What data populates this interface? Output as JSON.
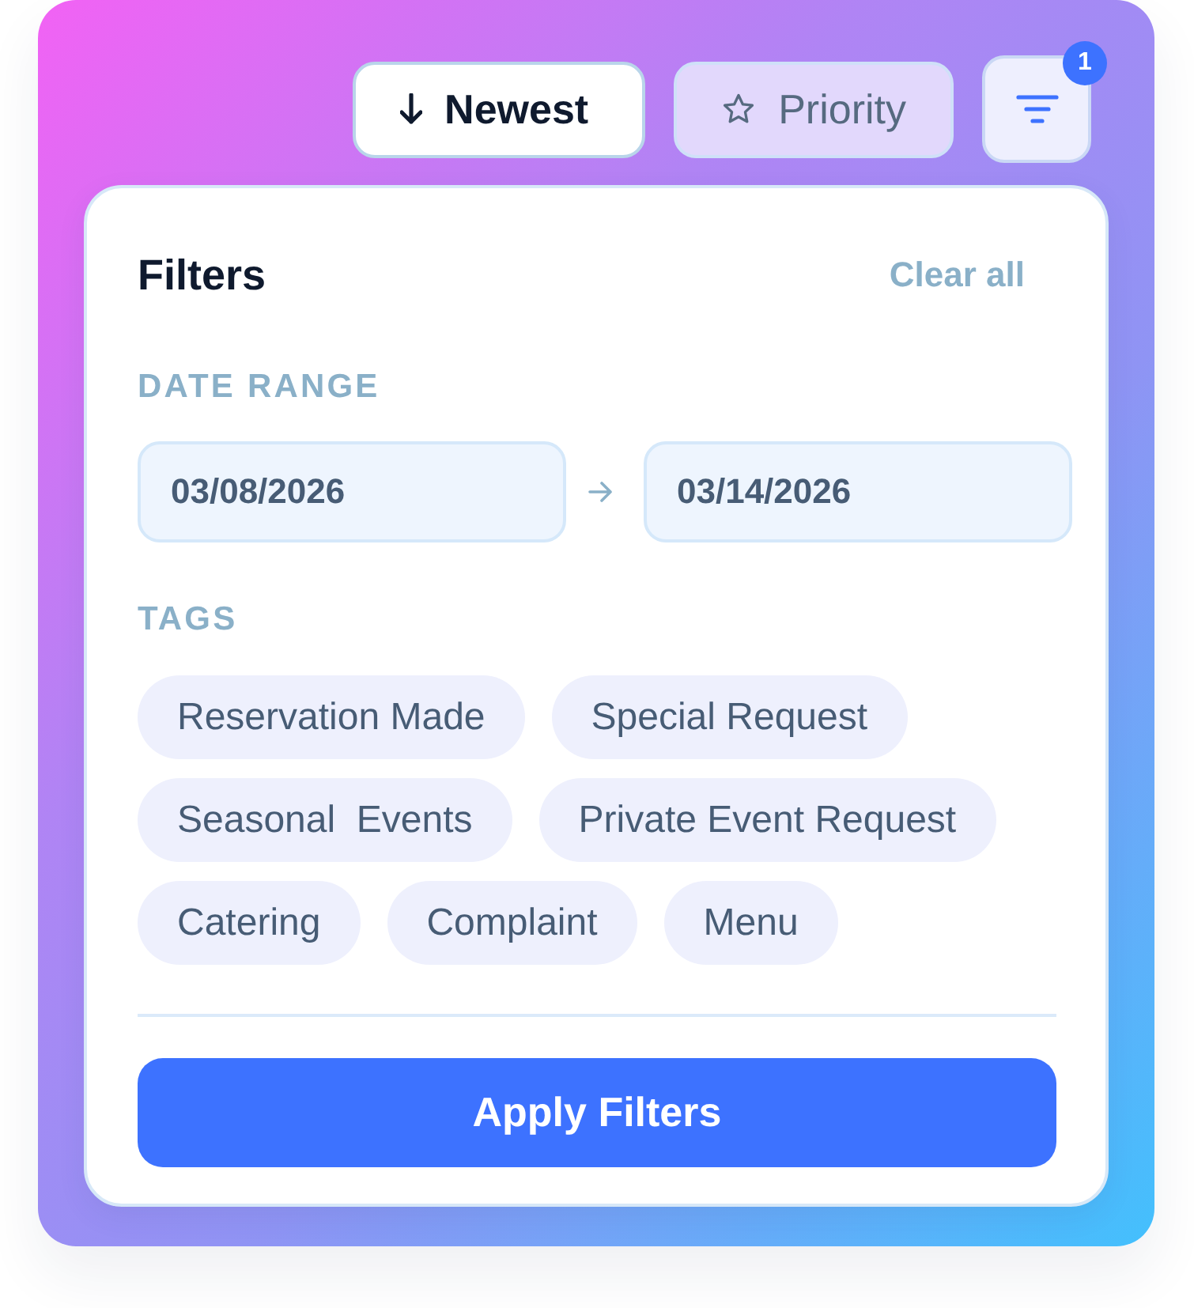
{
  "toolbar": {
    "sort_options": [
      {
        "kind": "arrow",
        "label": "Newest",
        "selected": true
      },
      {
        "kind": "star",
        "label": "Priority",
        "selected": false
      }
    ],
    "filter_button": {
      "badge": "1"
    }
  },
  "filters": {
    "title": "Filters",
    "clear_label": "Clear all",
    "date_range": {
      "label": "DATE RANGE",
      "start": "03/08/2026",
      "end": "03/14/2026"
    },
    "tags": {
      "label": "TAGS",
      "items": [
        {
          "label": "Reservation Made"
        },
        {
          "label": "Special Request"
        },
        {
          "label": "Seasonal  Events"
        },
        {
          "label": "Private Event Request"
        },
        {
          "label": "Catering"
        },
        {
          "label": "Complaint"
        },
        {
          "label": "Menu"
        }
      ]
    },
    "apply_label": "Apply Filters"
  }
}
